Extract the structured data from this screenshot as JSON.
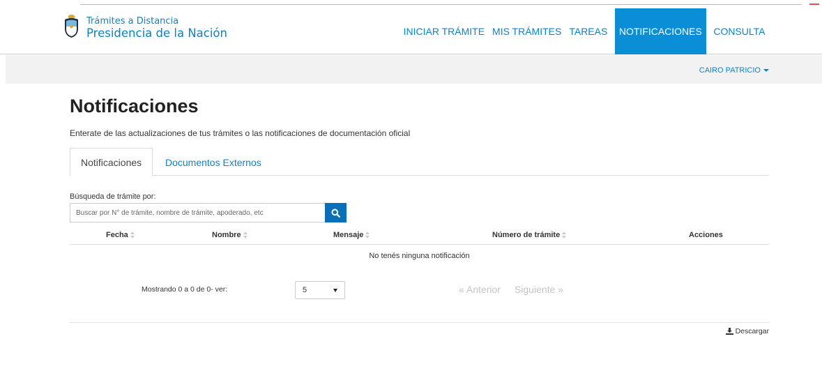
{
  "brand": {
    "line1": "Trámites a Distancia",
    "line2": "Presidencia de la Nación"
  },
  "nav": {
    "items": [
      {
        "label": "INICIAR TRÁMITE"
      },
      {
        "label": "MIS TRÁMITES"
      },
      {
        "label": "TAREAS"
      },
      {
        "label": "NOTIFICACIONES",
        "active": true
      },
      {
        "label": "CONSULTA"
      }
    ]
  },
  "user": {
    "name": "CAIRO PATRICIO"
  },
  "page": {
    "title": "Notificaciones",
    "description": "Enterate de las actualizaciones de tus trámites o las notificaciones de documentación oficial"
  },
  "tabs": [
    {
      "label": "Notificaciones",
      "active": true
    },
    {
      "label": "Documentos Externos",
      "active": false
    }
  ],
  "search": {
    "label": "Búsqueda de trámite por:",
    "placeholder": "Buscar por N° de trámite, nombre de trámite, apoderado, etc",
    "value": ""
  },
  "table": {
    "columns": [
      "Fecha",
      "Nombre",
      "Mensaje",
      "Número de trámite",
      "Acciones"
    ],
    "rows": [],
    "empty_message": "No tenés ninguna notificación"
  },
  "pagination": {
    "showing": "Mostrando 0 a 0 de 0- ver:",
    "page_size": "5",
    "prev_label": "« Anterior",
    "next_label": "Siguiente »"
  },
  "download": {
    "label": "Descargar"
  },
  "colors": {
    "brand_blue": "#0a83c4",
    "active_nav": "#0a8fd6",
    "search_button": "#0a6fb8"
  },
  "icons": {
    "logo": "coat-of-arms-icon",
    "search": "search-icon",
    "sort": "sort-icon",
    "download": "download-icon",
    "user_menu": "caret-down-icon"
  }
}
